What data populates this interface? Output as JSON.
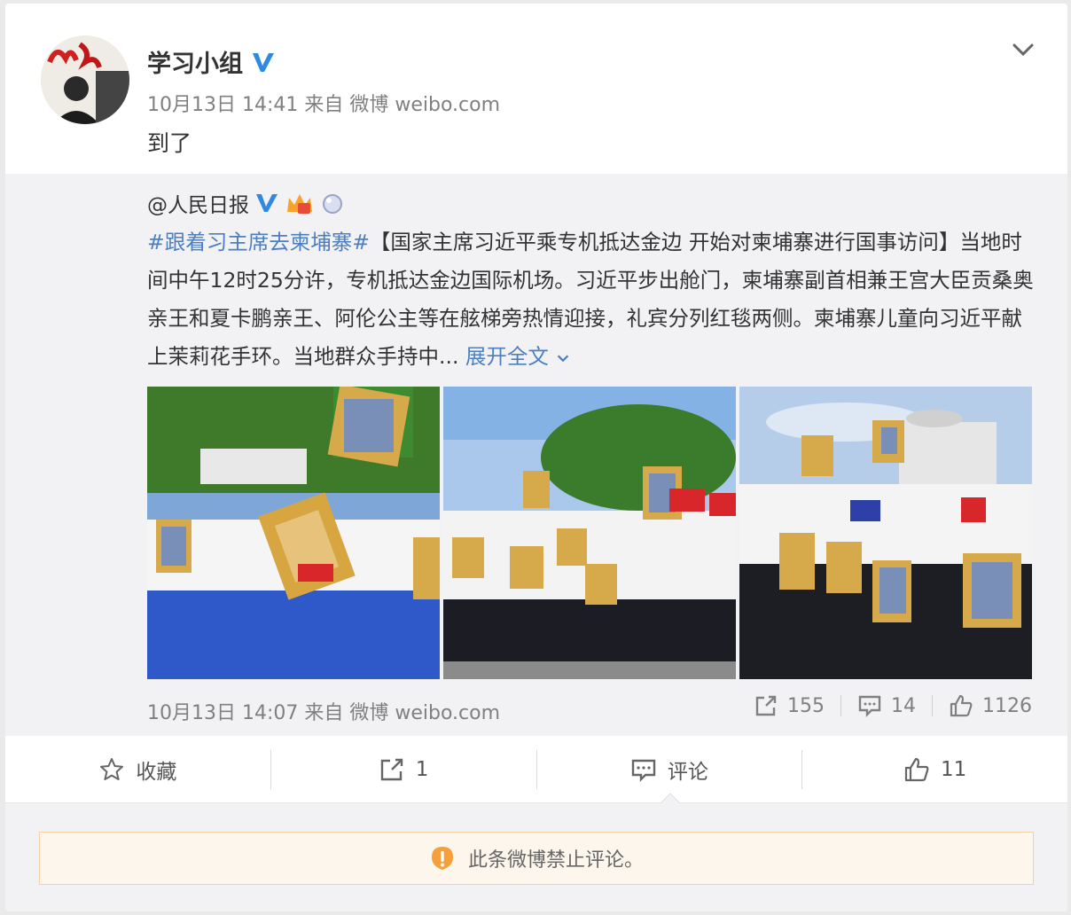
{
  "post": {
    "username": "学习小组",
    "avatar_text": "学习小组",
    "meta": "10月13日 14:41 来自 微博 weibo.com",
    "text": "到了"
  },
  "repost": {
    "username": "@人民日报",
    "hashtag": "#跟着习主席去柬埔寨#",
    "body": "【国家主席习近平乘专机抵达金边 开始对柬埔寨进行国事访问】当地时间中午12时25分许，专机抵达金边国际机场。习近平步出舱门，柬埔寨副首相兼王宫大臣贡桑奥亲王和夏卡鹏亲王、阿伦公主等在舷梯旁热情迎接，礼宾分列红毯两侧。柬埔寨儿童向习近平献上茉莉花手环。当地群众手持中...",
    "expand_label": "展开全文",
    "meta": "10月13日 14:07 来自 微博 weibo.com",
    "shares": "155",
    "comments": "14",
    "likes": "1126"
  },
  "actions": {
    "favorite": "收藏",
    "share_count": "1",
    "comment": "评论",
    "like_count": "11"
  },
  "notice": {
    "text": "此条微博禁止评论。"
  },
  "colors": {
    "link": "#4c7fc1",
    "verified": "#2d8ae0",
    "warning": "#f5a03a"
  },
  "icons": [
    "chevron-down-icon",
    "verified-icon",
    "vip-crown-icon",
    "share-icon",
    "comment-icon",
    "like-icon",
    "star-icon",
    "warning-icon"
  ]
}
